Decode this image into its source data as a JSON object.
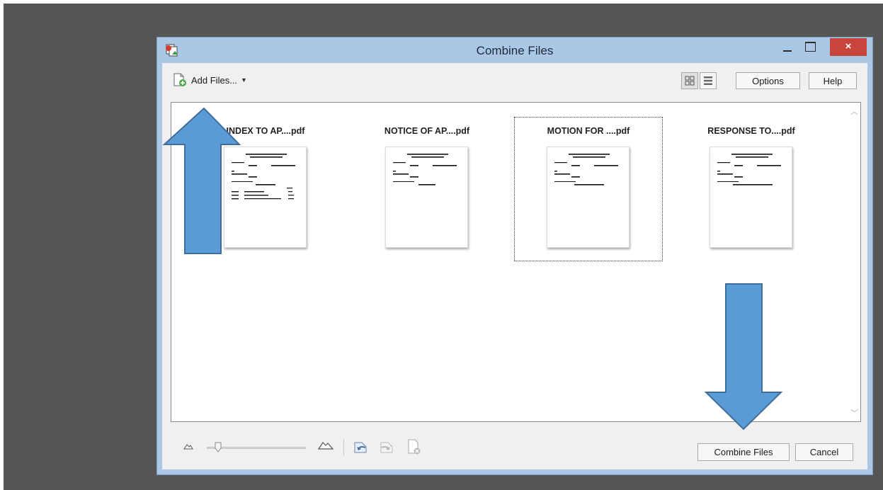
{
  "window": {
    "title": "Combine Files",
    "close_glyph": "×"
  },
  "toolbar": {
    "add_files_label": "Add Files...",
    "options_label": "Options",
    "help_label": "Help"
  },
  "files": [
    {
      "name": "INDEX TO AP....pdf",
      "selected": false
    },
    {
      "name": "NOTICE OF AP....pdf",
      "selected": false
    },
    {
      "name": "MOTION FOR ....pdf",
      "selected": true
    },
    {
      "name": "RESPONSE TO....pdf",
      "selected": false
    }
  ],
  "footer": {
    "combine_label": "Combine Files",
    "cancel_label": "Cancel"
  },
  "colors": {
    "titlebar": "#aac7e6",
    "close_button": "#c7453b",
    "annotation_arrow": "#5b9bd5",
    "desktop": "#555555"
  },
  "icons": [
    "app-icon",
    "add-file-icon",
    "thumbnail-view-icon",
    "list-view-icon",
    "zoom-out-icon",
    "zoom-in-icon",
    "undo-icon",
    "redo-icon",
    "remove-file-icon"
  ]
}
